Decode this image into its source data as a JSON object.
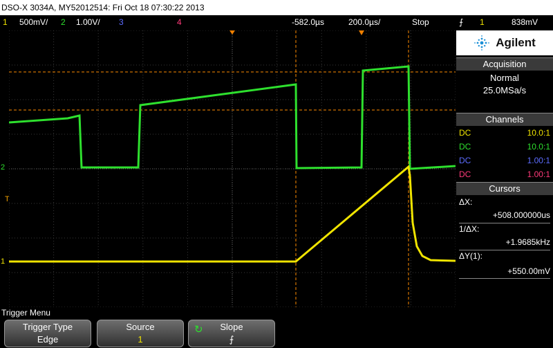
{
  "title": "DSO-X 3034A, MY52012514: Fri Oct 18 07:30:22 2013",
  "status": {
    "ch1_num": "1",
    "ch1_scale": "500mV/",
    "ch2_num": "2",
    "ch2_scale": "1.00V/",
    "ch3_num": "3",
    "ch4_num": "4",
    "time_delay": "-582.0µs",
    "time_scale": "200.0µs/",
    "run_state": "Stop",
    "trigger_source": "1",
    "trigger_level": "838mV"
  },
  "brand": "Agilent",
  "acquisition": {
    "header": "Acquisition",
    "mode": "Normal",
    "rate": "25.0MSa/s"
  },
  "channels": {
    "header": "Channels",
    "rows": [
      {
        "coupling": "DC",
        "probe": "10.0:1",
        "color": "#f0e400"
      },
      {
        "coupling": "DC",
        "probe": "10.0:1",
        "color": "#2ee02e"
      },
      {
        "coupling": "DC",
        "probe": "1.00:1",
        "color": "#5c6cff"
      },
      {
        "coupling": "DC",
        "probe": "1.00:1",
        "color": "#ff3a7a"
      }
    ]
  },
  "cursors": {
    "header": "Cursors",
    "dx_label": "ΔX:",
    "dx_value": "+508.000000us",
    "inv_label": "1/ΔX:",
    "inv_value": "+1.9685kHz",
    "dy_label": "ΔY(1):",
    "dy_value": "+550.00mV"
  },
  "menu": {
    "title": "Trigger Menu",
    "softkeys": [
      {
        "label": "Trigger Type",
        "value": "Edge"
      },
      {
        "label": "Source",
        "value": "1"
      },
      {
        "label": "Slope",
        "value": "rising-edge-icon"
      }
    ]
  },
  "markers": {
    "ch1": "1",
    "ch2": "2",
    "trigger": "T"
  },
  "colors": {
    "ch1": "#f0e400",
    "ch2": "#2ee02e",
    "ch3": "#5c6cff",
    "ch4": "#ff3a7a",
    "cursor": "#ff8c00"
  }
}
